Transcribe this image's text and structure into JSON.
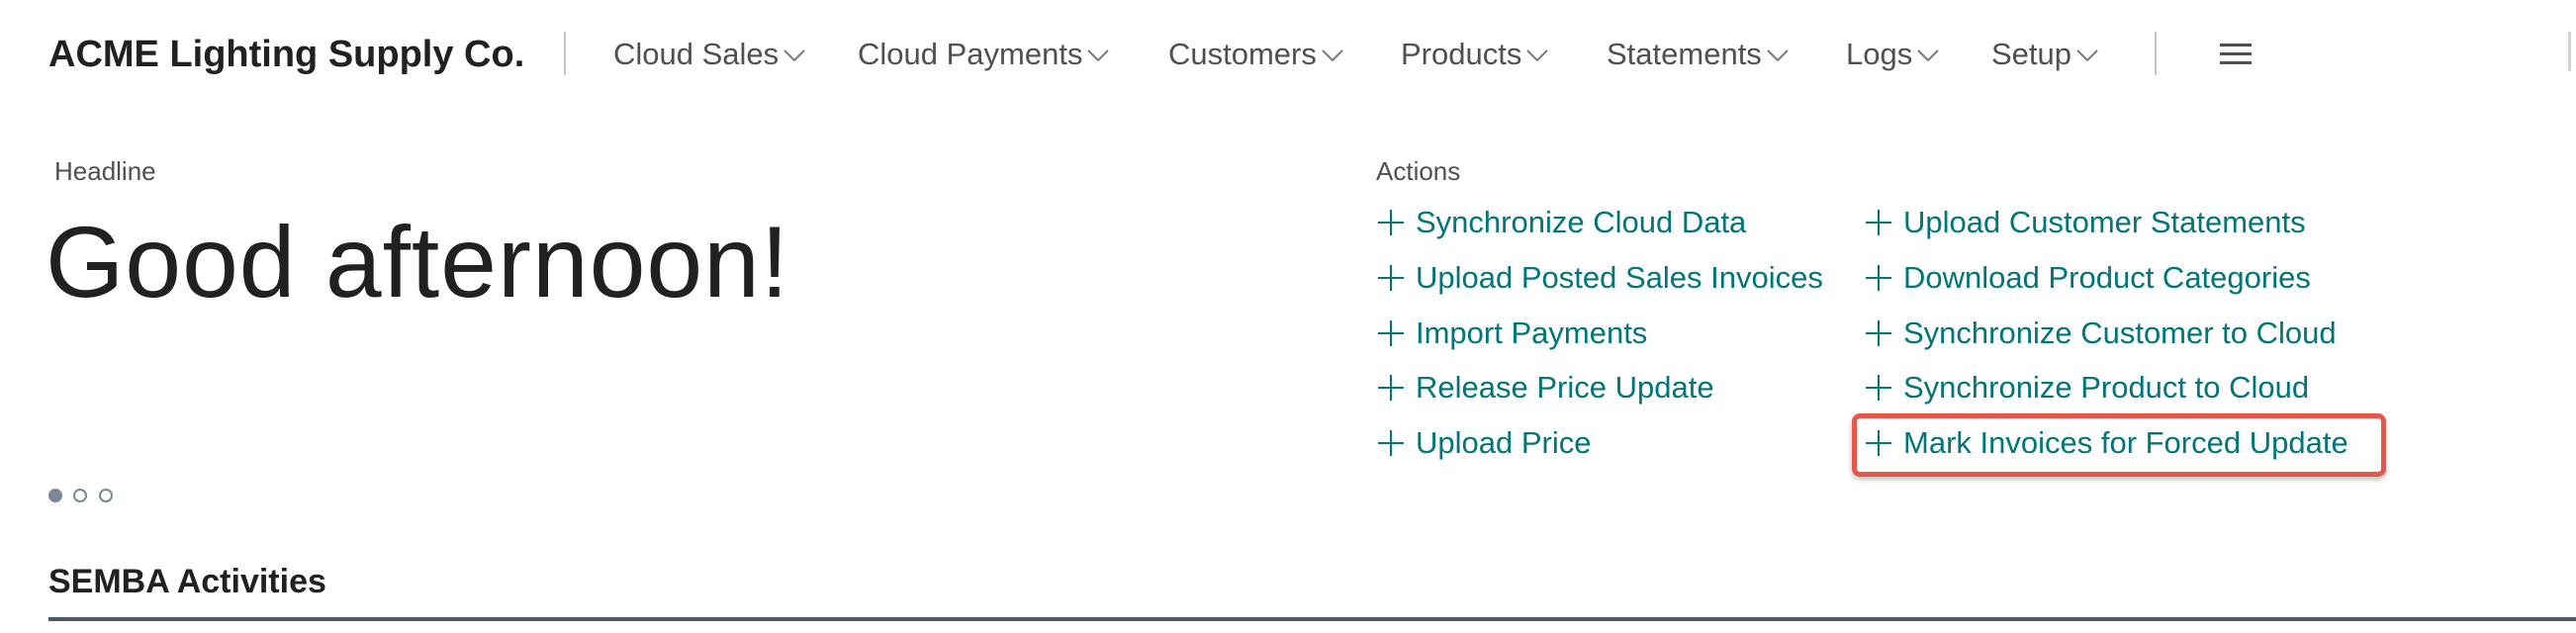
{
  "brand": "ACME Lighting Supply Co.",
  "nav": {
    "items": [
      {
        "label": "Cloud Sales"
      },
      {
        "label": "Cloud Payments"
      },
      {
        "label": "Customers"
      },
      {
        "label": "Products"
      },
      {
        "label": "Statements"
      },
      {
        "label": "Logs"
      },
      {
        "label": "Setup"
      }
    ],
    "menu_icon": "hamburger-icon",
    "chevron_icon": "chevron-down-icon"
  },
  "headline": {
    "caption": "Headline",
    "greeting": "Good afternoon!",
    "pager": {
      "count": 3,
      "active_index": 0
    }
  },
  "actions": {
    "caption": "Actions",
    "left": [
      {
        "label": "Synchronize Cloud Data"
      },
      {
        "label": "Upload Posted Sales Invoices"
      },
      {
        "label": "Import Payments"
      },
      {
        "label": "Release Price Update"
      },
      {
        "label": "Upload Price"
      }
    ],
    "right": [
      {
        "label": "Upload Customer Statements"
      },
      {
        "label": "Download Product Categories"
      },
      {
        "label": "Synchronize Customer to Cloud"
      },
      {
        "label": "Synchronize Product to Cloud"
      },
      {
        "label": "Mark Invoices for Forced Update"
      }
    ],
    "highlighted": "Mark Invoices for Forced Update",
    "icon": "plus-icon"
  },
  "section": {
    "title": "SEMBA Activities"
  },
  "colors": {
    "accent": "#00757a",
    "highlight_border": "#e8564a",
    "text": "#212121",
    "muted": "#505050"
  }
}
